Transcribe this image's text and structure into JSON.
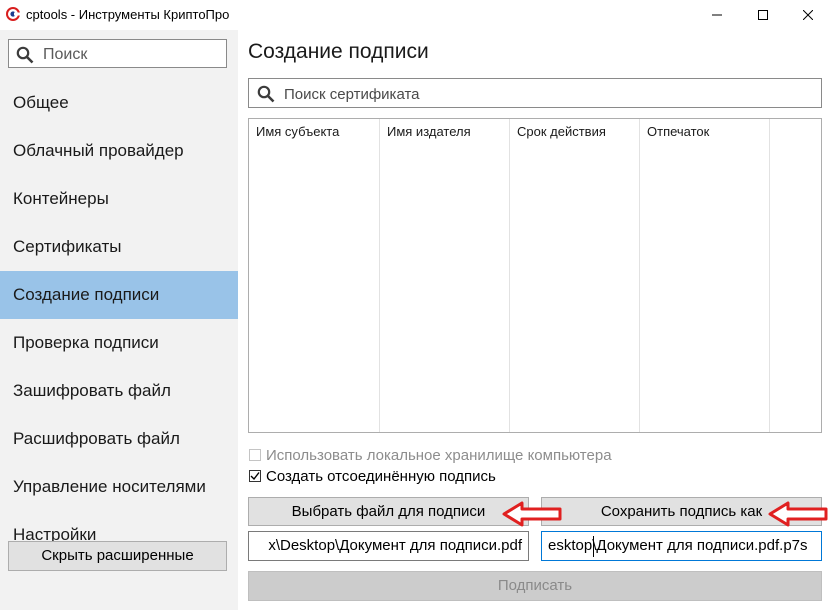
{
  "window": {
    "title": "cptools - Инструменты КриптоПро",
    "controls": {
      "minimize_icon": "minimize-icon",
      "maximize_icon": "maximize-icon",
      "close_icon": "close-icon"
    }
  },
  "sidebar": {
    "search_placeholder": "Поиск",
    "items": [
      {
        "label": "Общее",
        "active": false
      },
      {
        "label": "Облачный провайдер",
        "active": false
      },
      {
        "label": "Контейнеры",
        "active": false
      },
      {
        "label": "Сертификаты",
        "active": false
      },
      {
        "label": "Создание подписи",
        "active": true
      },
      {
        "label": "Проверка подписи",
        "active": false
      },
      {
        "label": "Зашифровать файл",
        "active": false
      },
      {
        "label": "Расшифровать файл",
        "active": false
      },
      {
        "label": "Управление носителями",
        "active": false
      },
      {
        "label": "Настройки",
        "active": false
      }
    ],
    "hide_button": "Скрыть расширенные"
  },
  "main": {
    "title": "Создание подписи",
    "cert_search_placeholder": "Поиск сертификата",
    "table": {
      "columns": [
        "Имя субъекта",
        "Имя издателя",
        "Срок действия",
        "Отпечаток"
      ],
      "rows": []
    },
    "options": {
      "use_local_store": {
        "label": "Использовать локальное хранилище компьютера",
        "checked": false,
        "enabled": false
      },
      "detached_signature": {
        "label": "Создать отсоединённую подпись",
        "checked": true,
        "enabled": true
      }
    },
    "select_file_button": "Выбрать файл для подписи",
    "save_signature_button": "Сохранить подпись как",
    "input_path_visible": "x\\Desktop\\Документ для подписи.pdf",
    "output_path_visible": "esktop\\Документ для подписи.pdf.p7s",
    "sign_button": "Подписать"
  },
  "colors": {
    "sidebar_bg": "#f2f2f2",
    "active_item_bg": "#99c3e8",
    "button_bg": "#e1e1e1",
    "annotation_arrow": "#e02020",
    "focus_border": "#0078d7"
  }
}
